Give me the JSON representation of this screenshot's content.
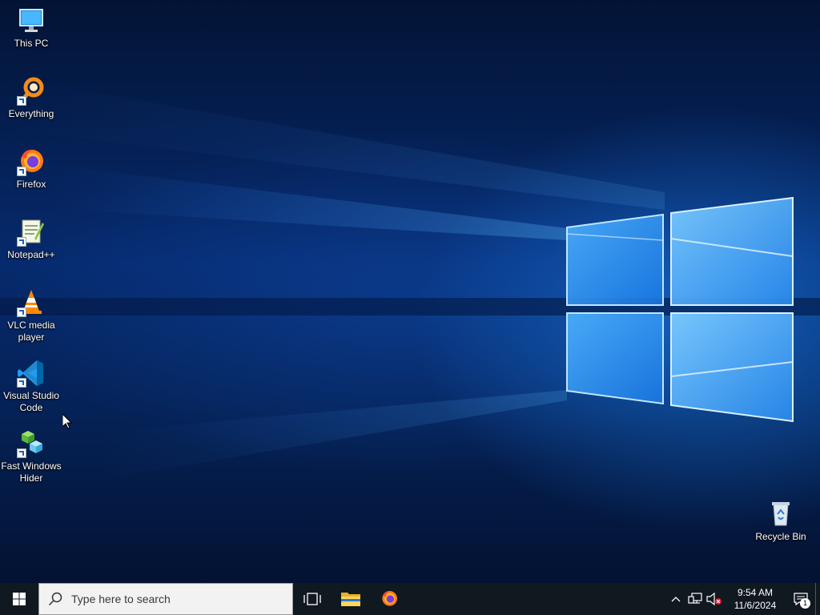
{
  "desktop": {
    "icons": [
      {
        "label": "This PC",
        "icon": "monitor-icon"
      },
      {
        "label": "Everything",
        "icon": "everything-search-icon"
      },
      {
        "label": "Firefox",
        "icon": "firefox-icon"
      },
      {
        "label": "Notepad++",
        "icon": "notepad-plus-plus-icon"
      },
      {
        "label": "VLC media\nplayer",
        "icon": "vlc-cone-icon"
      },
      {
        "label": "Visual Studio\nCode",
        "icon": "vscode-icon"
      },
      {
        "label": "Fast Windows\nHider",
        "icon": "cubes-icon"
      },
      {
        "label": "Recycle Bin",
        "icon": "recycle-bin-icon"
      }
    ]
  },
  "taskbar": {
    "search_placeholder": "Type here to search",
    "pinned": [
      {
        "name": "Task View",
        "icon": "task-view-icon"
      },
      {
        "name": "File Explorer",
        "icon": "folder-icon"
      },
      {
        "name": "Firefox",
        "icon": "firefox-icon"
      }
    ],
    "clock": {
      "time": "9:54 AM",
      "date": "11/6/2024"
    },
    "notification_count": "1"
  },
  "colors": {
    "taskbar_bg": "#101820",
    "wallpaper_accent": "#1e8cff"
  }
}
